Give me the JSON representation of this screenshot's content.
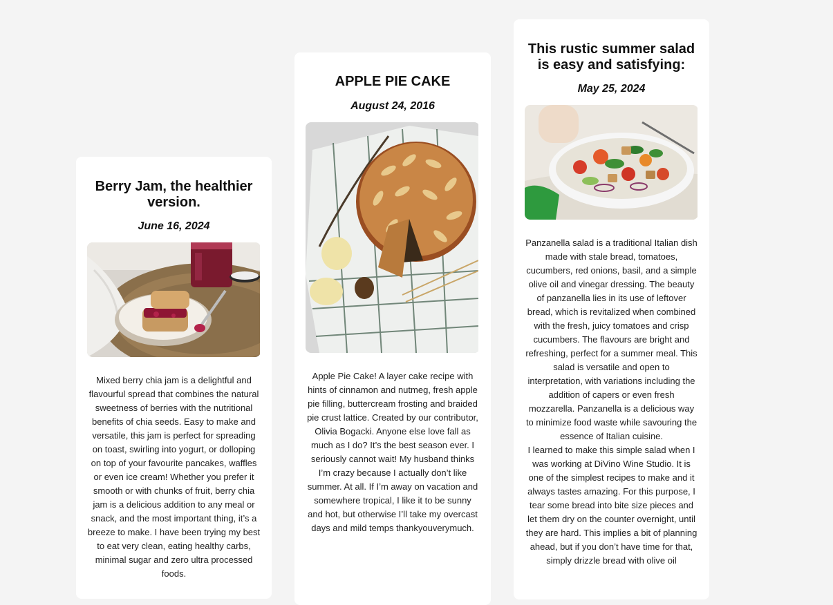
{
  "posts": [
    {
      "title": "Berry Jam, the healthier version.",
      "date": "June 16, 2024",
      "image": "berry-jam-scone-photo",
      "paragraphs": [
        "Mixed berry chia jam is a delightful and flavourful spread that combines the natural sweetness of berries with the nutritional benefits of chia seeds. Easy to make and versatile, this jam is perfect for spreading on toast, swirling into yogurt, or dolloping on top of your favourite pancakes, waffles or even ice cream! Whether you prefer it smooth or with chunks of fruit, berry chia jam is a delicious addition to any meal or snack, and the most important thing, it’s a breeze to make. I have been trying my best to eat very clean, eating healthy carbs, minimal sugar and zero ultra processed foods."
      ]
    },
    {
      "title": "APPLE PIE CAKE",
      "date": "August 24, 2016",
      "image": "apple-pie-cake-photo",
      "paragraphs": [
        "Apple Pie Cake! A layer cake recipe with hints of cinnamon and nutmeg, fresh apple pie filling, buttercream frosting and braided pie crust lattice. Created by our contributor, Olivia Bogacki. Anyone else love fall as much as I do? It’s the best season ever. I seriously cannot wait! My husband thinks I’m crazy because I actually don’t like summer. At all. If I’m away on vacation and somewhere tropical, I like it to be sunny and hot, but otherwise I’ll take my overcast days and mild temps thankyouverymuch."
      ]
    },
    {
      "title": "This rustic summer salad is easy and satisfying:",
      "date": "May 25, 2024",
      "image": "panzanella-salad-photo",
      "paragraphs": [
        "Panzanella salad is a traditional Italian dish made with stale bread, tomatoes, cucumbers, red onions, basil, and a simple olive oil and vinegar dressing. The beauty of panzanella lies in its use of leftover bread, which is revitalized when combined with the fresh, juicy tomatoes and crisp cucumbers. The flavours are bright and refreshing, perfect for a summer meal. This salad is versatile and open to interpretation, with variations including the addition of capers or even fresh mozzarella. Panzanella is a delicious way to minimize food waste while savouring the essence of Italian cuisine.",
        "I learned to make this simple salad when I was working at DiVino Wine Studio. It is one of the simplest recipes to make and it always tastes amazing. For this purpose, I tear some bread into bite size pieces and let them dry on the counter overnight, until they are hard. This implies a bit of planning ahead, but if you don’t have time for that, simply drizzle bread with olive oil"
      ]
    }
  ]
}
